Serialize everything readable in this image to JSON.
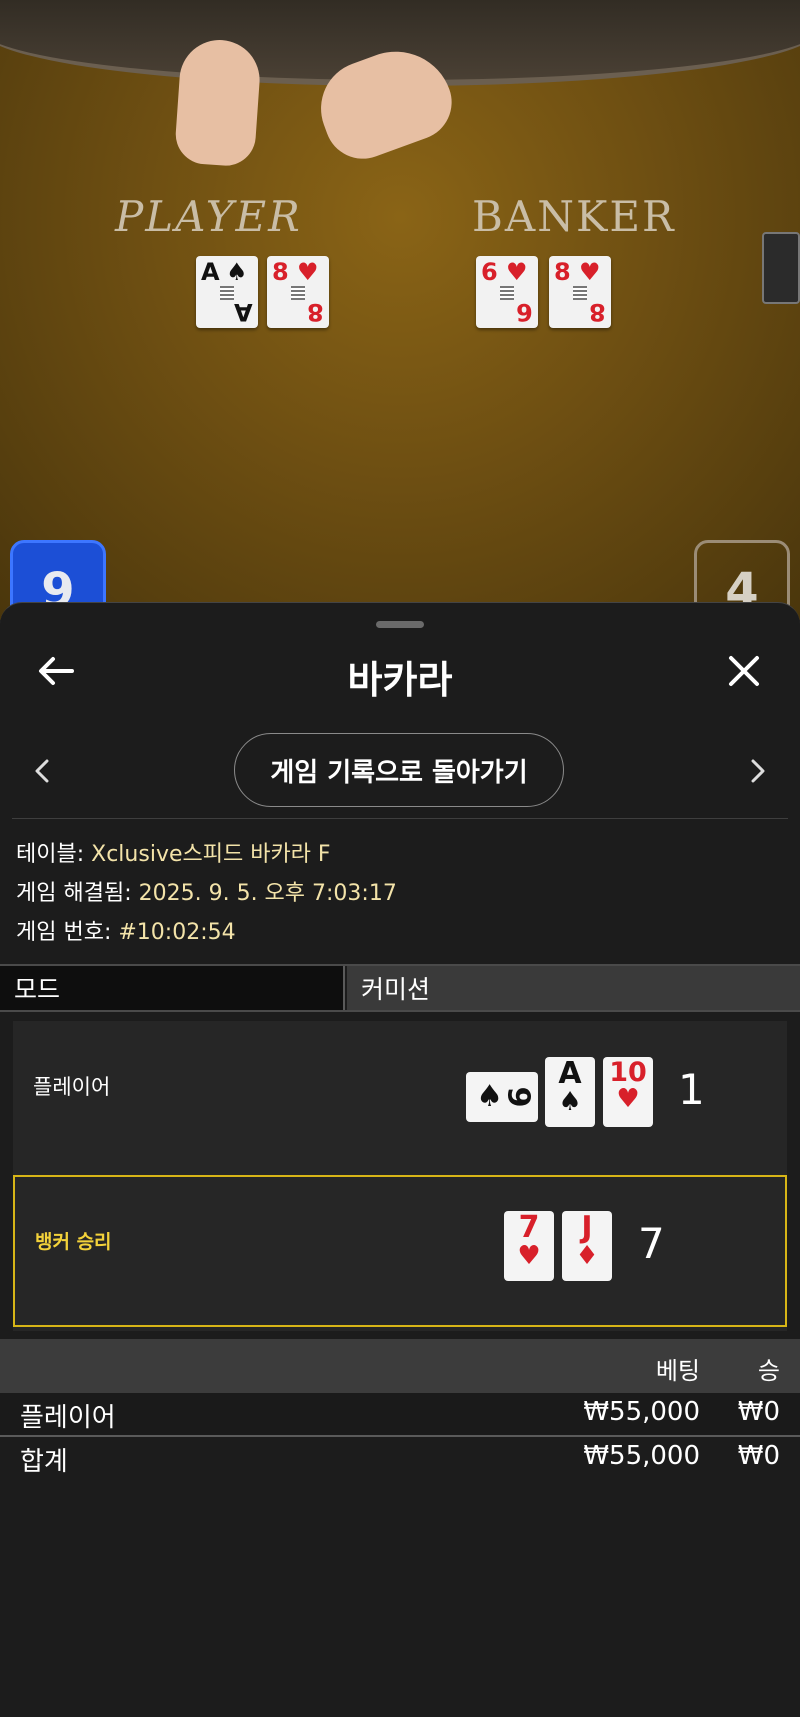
{
  "table_view": {
    "player_label": "PLAYER",
    "banker_label": "BANKER",
    "player_cards": [
      {
        "rank": "A",
        "suit": "♠",
        "color": "black"
      },
      {
        "rank": "8",
        "suit": "♥",
        "color": "red"
      }
    ],
    "banker_cards": [
      {
        "rank": "6",
        "suit": "♥",
        "color": "red"
      },
      {
        "rank": "8",
        "suit": "♥",
        "color": "red"
      }
    ],
    "player_score": "9",
    "banker_score": "4"
  },
  "sheet": {
    "title": "바카라",
    "history_button": "게임 기록으로 돌아가기",
    "info": {
      "table_key": "테이블: ",
      "table_value": "Xclusive스피드 바카라 F",
      "resolved_key": "게임 해결됨: ",
      "resolved_value": "2025. 9. 5. 오후 7:03:17",
      "game_no_key": "게임 번호: ",
      "game_no_value": "#10:02:54"
    },
    "tabs": {
      "mode": "모드",
      "commission": "커미션"
    },
    "result": {
      "player": {
        "label": "플레이어",
        "total": "1",
        "side_card": {
          "rank": "9",
          "suit": "♠"
        },
        "cards": [
          {
            "rank": "A",
            "suit": "♠",
            "color": "black"
          },
          {
            "rank": "10",
            "suit": "♥",
            "color": "red"
          }
        ]
      },
      "banker": {
        "label": "뱅커 승리",
        "total": "7",
        "cards": [
          {
            "rank": "7",
            "suit": "♥",
            "color": "red"
          },
          {
            "rank": "J",
            "suit": "♦",
            "color": "red"
          }
        ]
      }
    },
    "bets": {
      "col_bet": "베팅",
      "col_win": "승",
      "rows": [
        {
          "name": "플레이어",
          "bet": "₩55,000",
          "win": "₩0"
        }
      ],
      "total": {
        "name": "합계",
        "bet": "₩55,000",
        "win": "₩0"
      }
    }
  },
  "colors": {
    "win_border": "#d7b517",
    "info_value": "#f3e3a9",
    "player_badge": "#1c4fd6"
  },
  "icons": [
    "back-arrow-icon",
    "close-icon",
    "chevron-left-icon",
    "chevron-right-icon"
  ]
}
